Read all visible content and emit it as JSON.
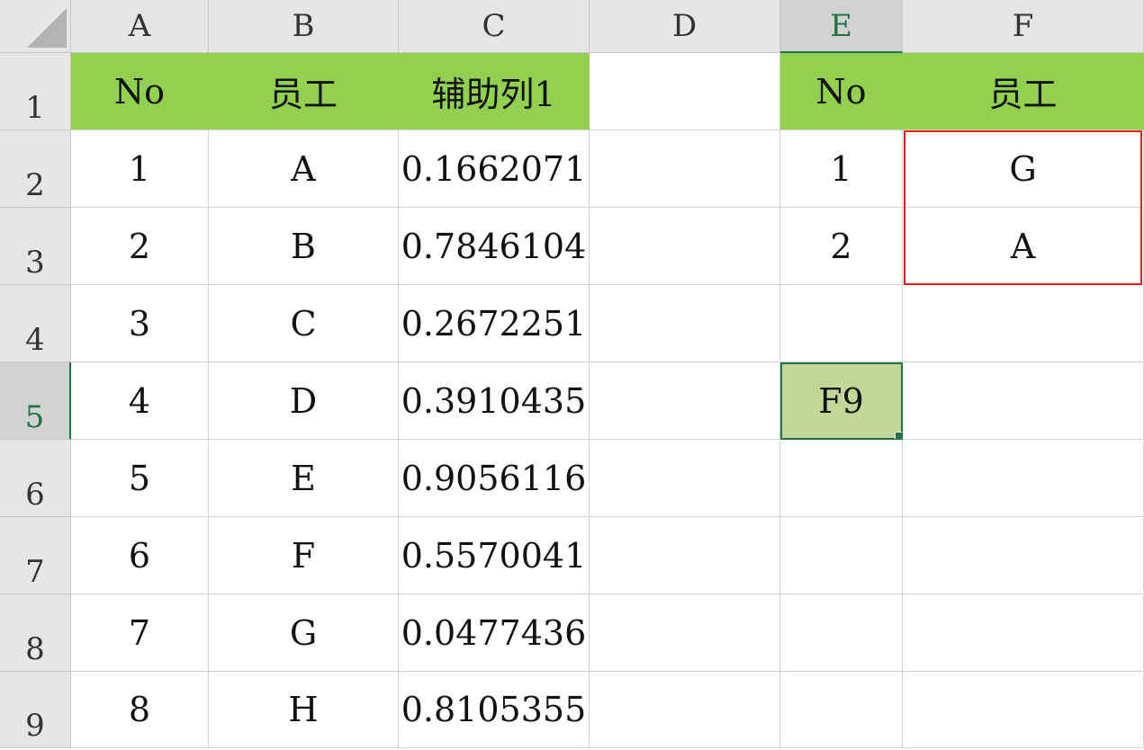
{
  "columns": [
    "A",
    "B",
    "C",
    "D",
    "E",
    "F"
  ],
  "rows": [
    "1",
    "2",
    "3",
    "4",
    "5",
    "6",
    "7",
    "8",
    "9"
  ],
  "active_cell": "E5",
  "colors": {
    "header_fill": "#92d050",
    "selection_fill": "#c4d79b",
    "selection_border": "#217346",
    "highlight_border": "#e2231a"
  },
  "table1": {
    "headers": [
      "No",
      "员工",
      "辅助列1"
    ],
    "rows": [
      [
        "1",
        "A",
        "0.1662071"
      ],
      [
        "2",
        "B",
        "0.7846104"
      ],
      [
        "3",
        "C",
        "0.2672251"
      ],
      [
        "4",
        "D",
        "0.3910435"
      ],
      [
        "5",
        "E",
        "0.9056116"
      ],
      [
        "6",
        "F",
        "0.5570041"
      ],
      [
        "7",
        "G",
        "0.0477436"
      ],
      [
        "8",
        "H",
        "0.8105355"
      ]
    ]
  },
  "table2": {
    "headers": [
      "No",
      "员工"
    ],
    "rows": [
      [
        "1",
        "G"
      ],
      [
        "2",
        "A"
      ]
    ]
  },
  "cells": {
    "E5": "F9"
  }
}
